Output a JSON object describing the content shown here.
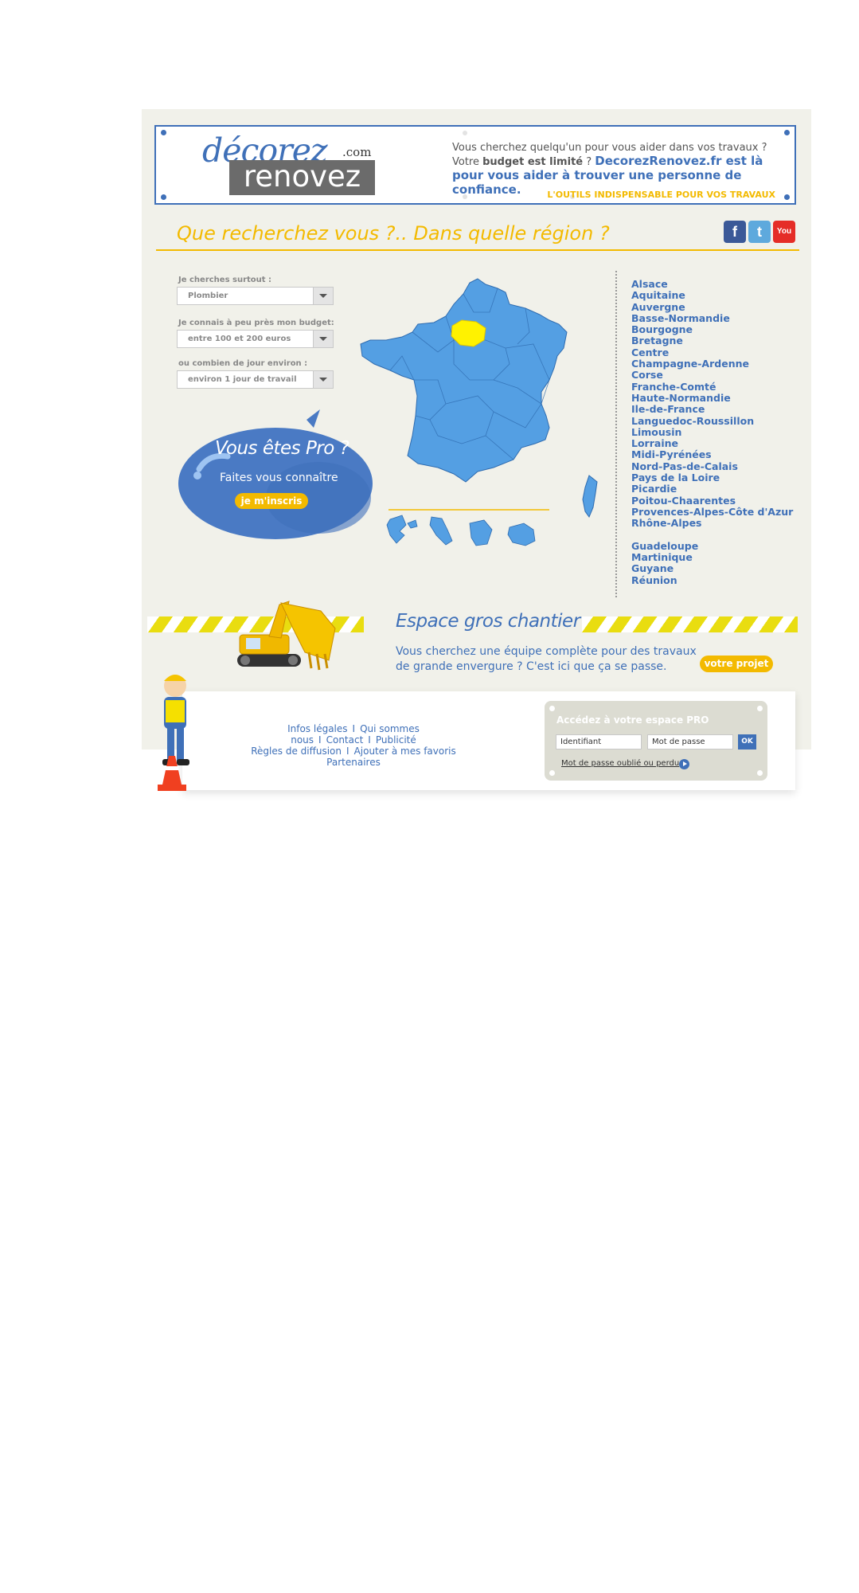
{
  "banner": {
    "logo_top": "décorez",
    "logo_com": ".com",
    "logo_bottom": "renovez",
    "tagline_line1": "Vous cherchez quelqu'un pour vous aider dans vos travaux ?",
    "tagline_votre": "Votre ",
    "tagline_bold": "budget est limité",
    "tagline_q": " ? ",
    "tagline_blue": "DecorezRenovez.fr est là pour vous aider à trouver une personne de confiance.",
    "outils": "L'OUTILS INDISPENSABLE POUR VOS TRAVAUX"
  },
  "title": "Que recherchez vous ?.. Dans quelle région ?",
  "social": [
    {
      "name": "facebook",
      "glyph": "f",
      "color": "#3b5998"
    },
    {
      "name": "twitter",
      "glyph": "t",
      "color": "#5ea9dd"
    },
    {
      "name": "youtube",
      "glyph": "You",
      "color": "#e52d27"
    }
  ],
  "form": {
    "label1": "Je cherches surtout :",
    "select1": "Plombier",
    "label2": "Je connais à peu près mon budget:",
    "select2": "entre 100 et 200 euros",
    "label3": "ou combien de jour environ :",
    "select3": "environ 1 jour de travail"
  },
  "pro": {
    "title": "Vous êtes Pro ?",
    "subtitle": "Faites vous connaître",
    "button": "je m'inscris"
  },
  "regions": [
    "Alsace",
    "Aquitaine",
    "Auvergne",
    "Basse-Normandie",
    "Bourgogne",
    "Bretagne",
    "Centre",
    "Champagne-Ardenne",
    "Corse",
    "Franche-Comté",
    "Haute-Normandie",
    "Ile-de-France",
    "Languedoc-Roussillon",
    "Limousin",
    "Lorraine",
    "Midi-Pyrénées",
    "Nord-Pas-de-Calais",
    "Pays de la Loire",
    "Picardie",
    "Poitou-Chaarentes",
    "Provences-Alpes-Côte d'Azur",
    "Rhône-Alpes"
  ],
  "dom": [
    "Guadeloupe",
    "Martinique",
    "Guyane",
    "Réunion"
  ],
  "map": {
    "highlighted_region": "Ile-de-France",
    "highlight_color": "#fff200",
    "base_color": "#549fe3"
  },
  "chantier": {
    "title": "Espace gros chantier",
    "text": "Vous cherchez une équipe complète pour des travaux de grande envergure ? C'est ici que ça se passe.",
    "button": "votre projet"
  },
  "footer": {
    "links_row1": [
      "Infos légales",
      "Qui sommes nous",
      "Contact",
      "Publicité"
    ],
    "links_row2": [
      "Règles de diffusion",
      "Ajouter à mes favoris"
    ],
    "links_row3": [
      "Partenaires"
    ],
    "separator": "I"
  },
  "login": {
    "title": "Accédez à votre espace PRO",
    "username_placeholder": "Identifiant",
    "password_placeholder": "Mot de passe",
    "ok": "OK",
    "forgot": "Mot de passe oublié ou perdu",
    "forgot_q": " ?"
  },
  "colors": {
    "brand_blue": "#3f70b8",
    "accent_yellow": "#f3ba00",
    "background": "#f1f1ea"
  }
}
